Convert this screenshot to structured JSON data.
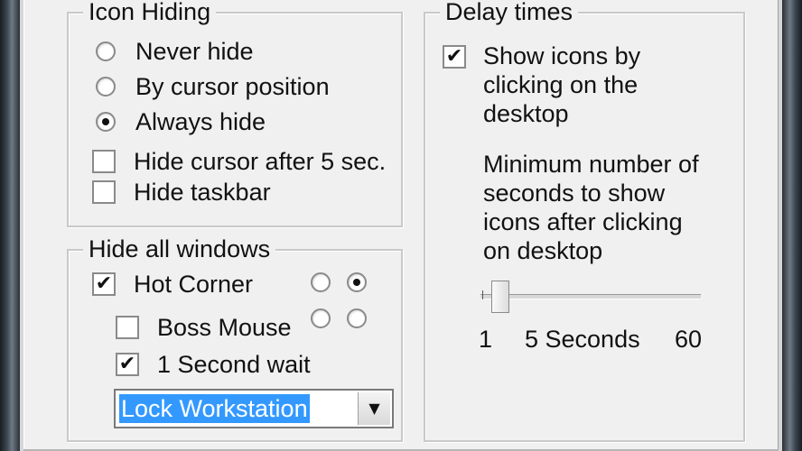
{
  "icon_hiding": {
    "legend": "Icon Hiding",
    "radios": [
      {
        "label": "Never hide",
        "checked": false
      },
      {
        "label": "By cursor position",
        "checked": false
      },
      {
        "label": "Always hide",
        "checked": true
      }
    ],
    "checkboxes": [
      {
        "label": "Hide cursor after 5 sec.",
        "checked": false
      },
      {
        "label": "Hide taskbar",
        "checked": false
      }
    ]
  },
  "hide_all_windows": {
    "legend": "Hide all windows",
    "hot_corner": {
      "label": "Hot Corner",
      "checked": true
    },
    "boss_mouse": {
      "label": "Boss Mouse",
      "checked": false
    },
    "second_wait": {
      "label": "1 Second wait",
      "checked": true
    },
    "corner_radios": [
      false,
      true,
      false,
      false
    ],
    "action_select": {
      "value": "Lock Workstation"
    }
  },
  "delay_times": {
    "legend": "Delay times",
    "show_icons": {
      "lines": [
        "Show icons by",
        "clicking on the",
        "desktop"
      ],
      "checked": true
    },
    "description_lines": [
      "Minimum number of",
      "seconds to show",
      "icons after clicking",
      "on desktop"
    ],
    "slider": {
      "min_label": "1",
      "value_label": "5 Seconds",
      "max_label": "60",
      "value": 5,
      "min": 1,
      "max": 60
    }
  },
  "icons": {
    "check": "✔",
    "dropdown_arrow": "▼"
  }
}
